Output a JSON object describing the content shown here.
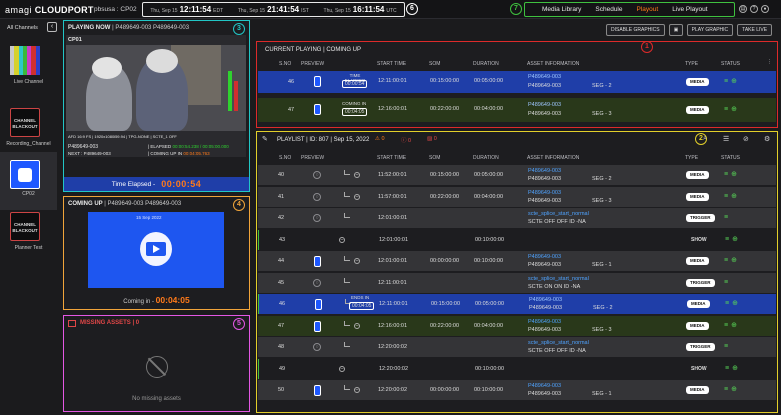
{
  "app": {
    "logo_brand": "amagi",
    "logo_product": "CLOUDPORT",
    "breadcrumb": "pbsusa : CP02"
  },
  "clocks": [
    {
      "date": "Thu, Sep 15",
      "time": "12:11:54",
      "tz": "EDT"
    },
    {
      "date": "Thu, Sep 15",
      "time": "21:41:54",
      "tz": "IST"
    },
    {
      "date": "Thu, Sep 15",
      "time": "16:11:54",
      "tz": "UTC"
    }
  ],
  "nav": {
    "tabs": [
      "Media Library",
      "Schedule",
      "Playout",
      "Live Playout"
    ],
    "active": "Playout"
  },
  "callouts": [
    "1",
    "2",
    "3",
    "4",
    "5",
    "6",
    "7"
  ],
  "channels": {
    "header": "All Channels",
    "items": [
      {
        "label": "Live Channel",
        "thumb": "color-bars"
      },
      {
        "label": "Recording_Channel",
        "thumb": "blackout",
        "text": "CHANNEL BLACKOUT"
      },
      {
        "label": "CP02",
        "thumb": "selected"
      },
      {
        "label": "Planner Test",
        "thumb": "blackout",
        "text": "CHANNEL BLACKOUT"
      }
    ]
  },
  "playing_now": {
    "title": "PLAYING NOW",
    "asset": "P489649-003 P489649-003",
    "channel_tag": "CP01",
    "overlay_info": "AFD 16:9 FS | 1920x1080i59.94 | TPG-NONE | SCTE_1 OFF",
    "clip_id": "P489649-003",
    "elapsed_label": "ELAPSED",
    "elapsed_value": "00:00:54.238 / 00:05:00.000",
    "next_label": "NEXT : P489649-003",
    "coming_up_label": "COMING UP IN",
    "coming_up_value": "00:04:05.763",
    "time_elapsed_label": "Time Elapsed -",
    "time_elapsed_value": "00:00:54"
  },
  "coming_up": {
    "title": "COMING UP",
    "asset": "P489649-003 P489649-003",
    "date_tag": "15 Sep 2022",
    "coming_in_label": "Coming in -",
    "coming_in_value": "00:04:05"
  },
  "missing": {
    "title": "MISSING ASSETS | 0",
    "empty_text": "No missing assets"
  },
  "top_buttons": {
    "disable_graphics": "DISABLE GRAPHICS",
    "play_graphic": "PLAY GRAPHIC",
    "take_live": "TAKE LIVE"
  },
  "current": {
    "title": "CURRENT PLAYING | COMING UP",
    "columns": [
      "S.NO",
      "PREVIEW",
      "START TIME",
      "SOM",
      "DURATION",
      "ASSET INFORMATION",
      "TYPE",
      "STATUS"
    ],
    "rows": [
      {
        "sno": "46",
        "tag_label": "TIME ELAPSED",
        "tag_value": "00:00:54",
        "start": "12:11:00:01",
        "som": "00:15:00:00",
        "dur": "00:05:00:00",
        "asset_top": "P489649-003",
        "asset_bottom": "P489649-003",
        "seg": "SEG - 2",
        "type": "MEDIA"
      },
      {
        "sno": "47",
        "tag_label": "COMING IN",
        "tag_value": "00:04:05",
        "start": "12:16:00:01",
        "som": "00:22:00:00",
        "dur": "00:04:00:00",
        "asset_top": "P489649-003",
        "asset_bottom": "P489649-003",
        "seg": "SEG - 3",
        "type": "MEDIA"
      }
    ]
  },
  "playlist": {
    "title": "PLAYLIST | ID: 807 | Sep 15, 2022",
    "warn_count": "0",
    "error_count": "0",
    "missing_count": "0",
    "columns": [
      "S.NO",
      "PREVIEW",
      "START TIME",
      "SOM",
      "DURATION",
      "ASSET INFORMATION",
      "TYPE",
      "STATUS"
    ],
    "rows": [
      {
        "sno": "40",
        "start": "11:52:00:01",
        "som": "00:15:00:00",
        "dur": "00:05:00:00",
        "a1": "P489649-003",
        "a2": "P489649-003",
        "seg": "SEG - 2",
        "type": "MEDIA",
        "kind": "media-past"
      },
      {
        "sno": "41",
        "start": "11:57:00:01",
        "som": "00:22:00:00",
        "dur": "00:04:00:00",
        "a1": "P489649-003",
        "a2": "P489649-003",
        "seg": "SEG - 3",
        "type": "MEDIA",
        "kind": "media-past"
      },
      {
        "sno": "42",
        "start": "12:01:00:01",
        "som": "",
        "dur": "",
        "a1": "scte_splice_start_normal",
        "a2": "SCTE OFF  OFF  ID -NA",
        "seg": "",
        "type": "TRIGGER",
        "kind": "trigger-past"
      },
      {
        "sno": "43",
        "start": "12:01:00:01",
        "som": "",
        "dur": "00:10:00:00",
        "a1": "",
        "a2": "",
        "seg": "",
        "type": "SHOW",
        "kind": "show"
      },
      {
        "sno": "44",
        "start": "12:01:00:01",
        "som": "00:00:00:00",
        "dur": "00:10:00:00",
        "a1": "P489649-003",
        "a2": "P489649-003",
        "seg": "SEG - 1",
        "type": "MEDIA",
        "kind": "media"
      },
      {
        "sno": "45",
        "start": "12:11:00:01",
        "som": "",
        "dur": "",
        "a1": "scte_splice_start_normal",
        "a2": "SCTE ON  ON  ID -NA",
        "seg": "",
        "type": "TRIGGER",
        "kind": "trigger"
      },
      {
        "sno": "46",
        "start": "12:11:00:01",
        "som": "00:15:00:00",
        "dur": "00:05:00:00",
        "a1": "P489649-003",
        "a2": "P489649-003",
        "seg": "SEG - 2",
        "type": "MEDIA",
        "kind": "current",
        "tag_label": "ENDS IN",
        "tag_value": "00:04:05"
      },
      {
        "sno": "47",
        "start": "12:16:00:01",
        "som": "00:22:00:00",
        "dur": "00:04:00:00",
        "a1": "P489649-003",
        "a2": "P489649-003",
        "seg": "SEG - 3",
        "type": "MEDIA",
        "kind": "next"
      },
      {
        "sno": "48",
        "start": "12:20:00:02",
        "som": "",
        "dur": "",
        "a1": "scte_splice_start_normal",
        "a2": "SCTE OFF  OFF  ID -NA",
        "seg": "",
        "type": "TRIGGER",
        "kind": "trigger-future"
      },
      {
        "sno": "49",
        "start": "12:20:00:02",
        "som": "",
        "dur": "00:10:00:00",
        "a1": "",
        "a2": "",
        "seg": "",
        "type": "SHOW",
        "kind": "show"
      },
      {
        "sno": "50",
        "start": "12:20:00:02",
        "som": "00:00:00:00",
        "dur": "00:10:00:00",
        "a1": "P489649-003",
        "a2": "P489649-003",
        "seg": "SEG - 1",
        "type": "MEDIA",
        "kind": "media"
      }
    ]
  },
  "colors": {
    "accent": "#ff7a1a",
    "selected_row": "#1f3ea8",
    "next_row": "#2a3a18",
    "cyan": "#22c6c6",
    "red": "#dd2a2a",
    "yellow": "#e2cf2a",
    "orange": "#f1a43a",
    "pink": "#e457e4",
    "green": "#3fc13f"
  }
}
